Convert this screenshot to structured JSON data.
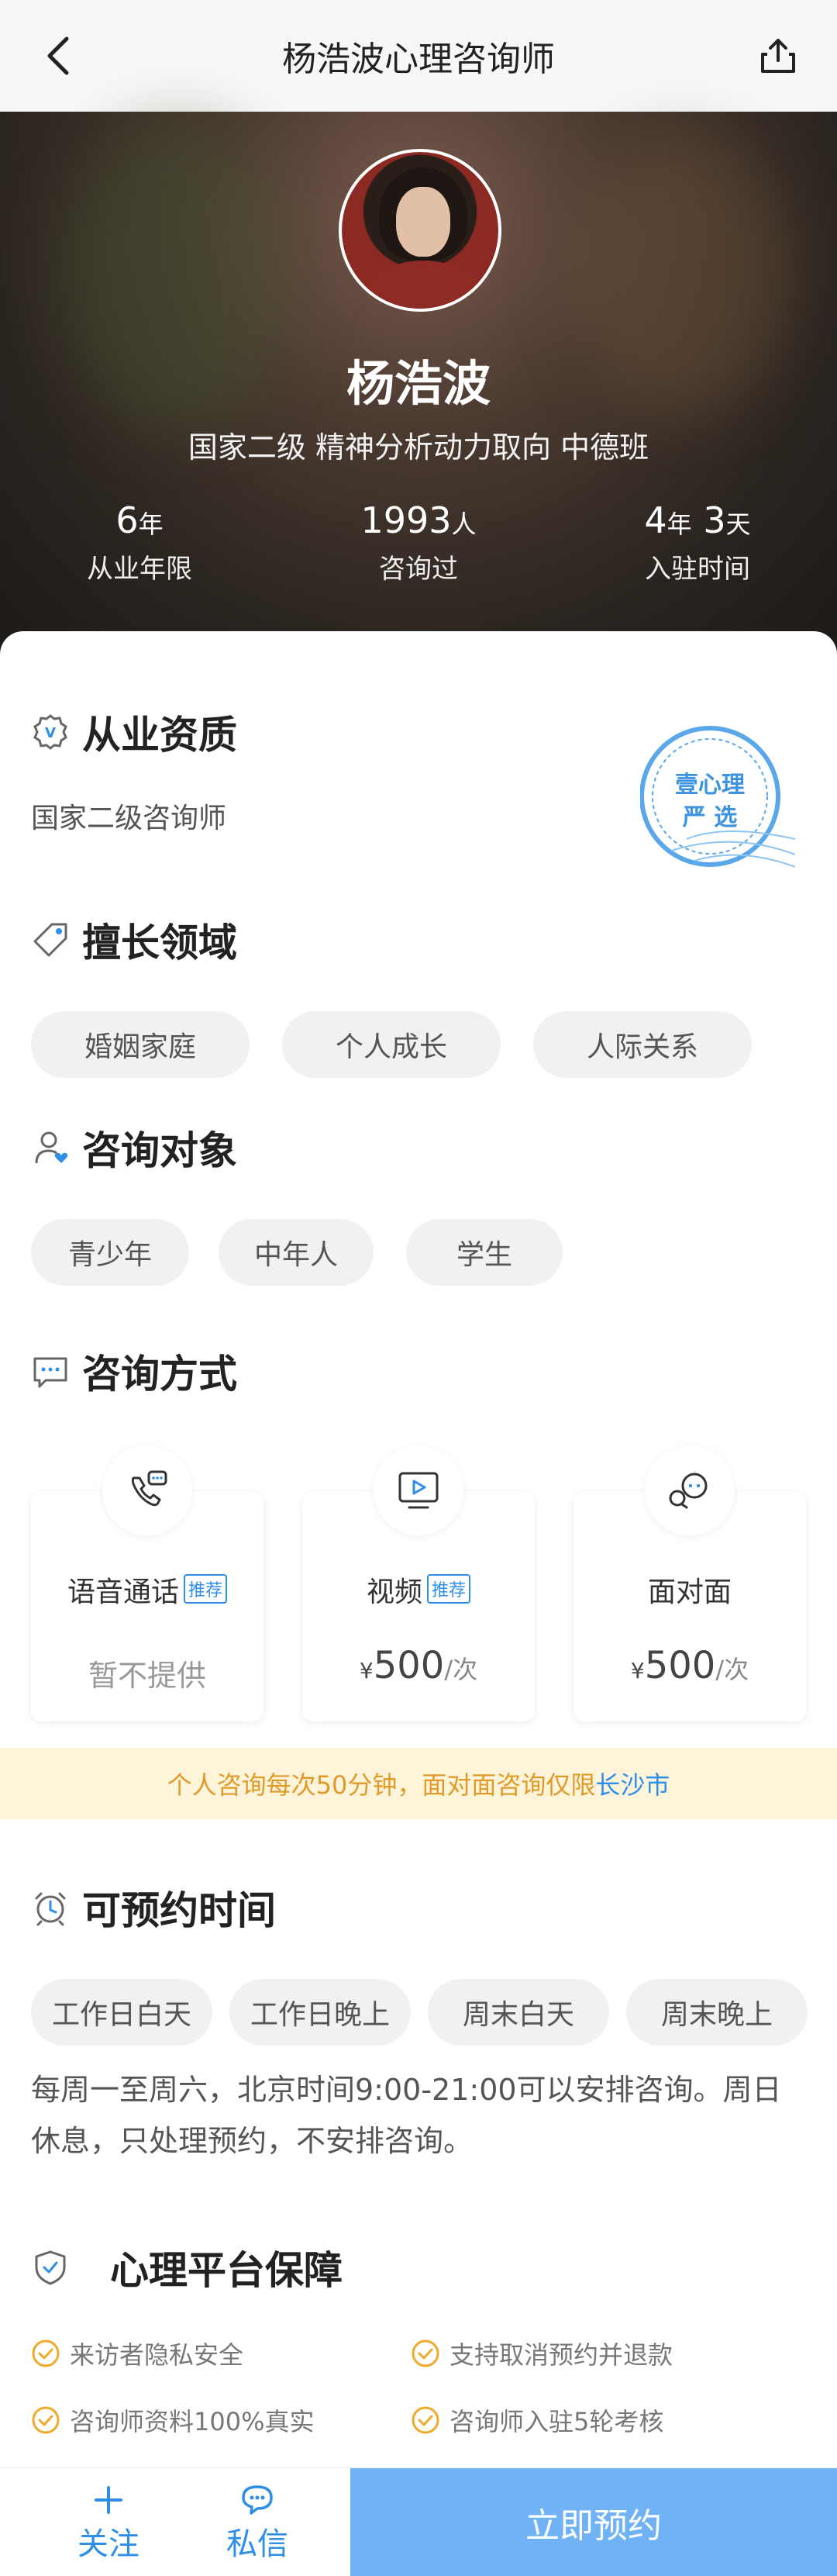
{
  "header": {
    "title": "杨浩波心理咨询师"
  },
  "profile": {
    "name": "杨浩波",
    "subtitle": "国家二级 精神分析动力取向 中德班",
    "stats": [
      {
        "num": "6",
        "unit": "年",
        "label": "从业年限"
      },
      {
        "num": "1993",
        "unit": "人",
        "label": "咨询过"
      },
      {
        "num": "4",
        "unit": "年",
        "num2": "3",
        "unit2": "天",
        "label": "入驻时间"
      }
    ]
  },
  "qualification": {
    "title": "从业资质",
    "text": "国家二级咨询师",
    "stamp_line1": "壹心理",
    "stamp_line2": "严 选"
  },
  "expertise": {
    "title": "擅长领域",
    "tags": [
      "婚姻家庭",
      "个人成长",
      "人际关系"
    ]
  },
  "audience": {
    "title": "咨询对象",
    "tags": [
      "青少年",
      "中年人",
      "学生"
    ]
  },
  "methods": {
    "title": "咨询方式",
    "items": [
      {
        "name": "语音通话",
        "badge": "推荐",
        "price": "暂不提供"
      },
      {
        "name": "视频",
        "badge": "推荐",
        "currency": "¥",
        "price": "500",
        "per": "/次"
      },
      {
        "name": "面对面",
        "currency": "¥",
        "price": "500",
        "per": "/次"
      }
    ]
  },
  "notice": {
    "text": "个人咨询每次50分钟，面对面咨询仅限",
    "city": "长沙市"
  },
  "availability": {
    "title": "可预约时间",
    "tags": [
      "工作日白天",
      "工作日晚上",
      "周末白天",
      "周末晚上"
    ],
    "desc": "每周一至周六，北京时间9:00-21:00可以安排咨询。周日休息，只处理预约，不安排咨询。"
  },
  "guarantee": {
    "title": "心理平台保障",
    "items": [
      "来访者隐私安全",
      "支持取消预约并退款",
      "咨询师资料100%真实",
      "咨询师入驻5轮考核"
    ]
  },
  "bottom": {
    "follow": "关注",
    "message": "私信",
    "book": "立即预约"
  },
  "colors": {
    "accent": "#2f8ee8",
    "book_bg": "#6fb3f6",
    "notice_bg": "#fdf4d9",
    "notice_text": "#e09a2a",
    "check": "#f0a92a"
  }
}
